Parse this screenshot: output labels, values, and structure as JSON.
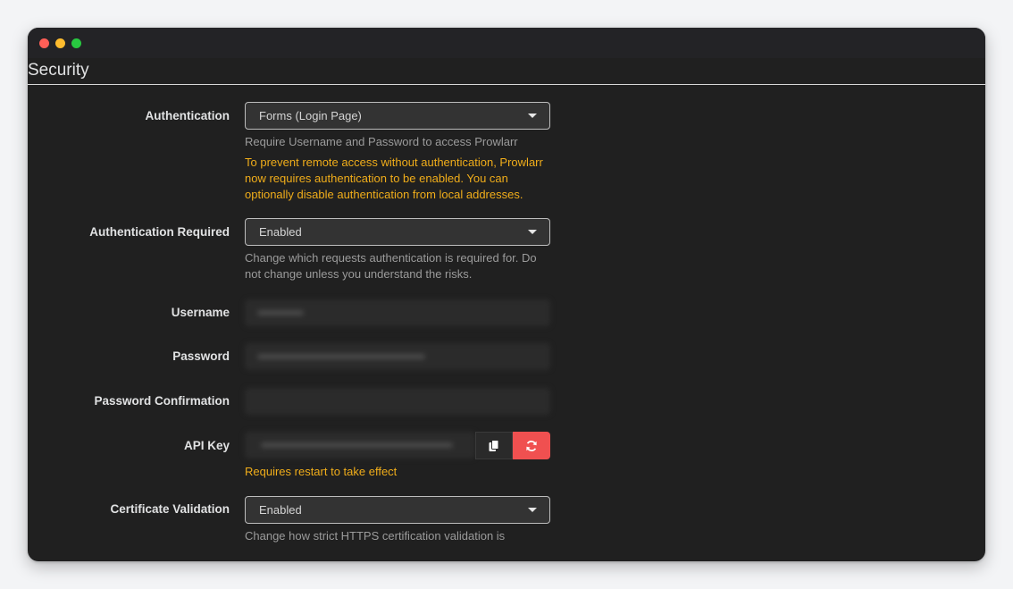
{
  "section": {
    "title": "Security"
  },
  "authentication": {
    "label": "Authentication",
    "value": "Forms (Login Page)",
    "help": "Require Username and Password to access Prowlarr",
    "warning": "To prevent remote access without authentication, Prowlarr now requires authentication to be enabled. You can optionally disable authentication from local addresses."
  },
  "authentication_required": {
    "label": "Authentication Required",
    "value": "Enabled",
    "help": "Change which requests authentication is required for. Do not change unless you understand the risks."
  },
  "username": {
    "label": "Username"
  },
  "password": {
    "label": "Password"
  },
  "password_confirmation": {
    "label": "Password Confirmation"
  },
  "api_key": {
    "label": "API Key",
    "warning": "Requires restart to take effect"
  },
  "certificate_validation": {
    "label": "Certificate Validation",
    "value": "Enabled",
    "help": "Change how strict HTTPS certification validation is"
  },
  "icons": {
    "copy": "copy-icon",
    "regenerate": "refresh-icon",
    "dropdown": "caret-down-icon"
  },
  "colors": {
    "accent_red": "#f05050",
    "warning": "#f0ad1a"
  }
}
